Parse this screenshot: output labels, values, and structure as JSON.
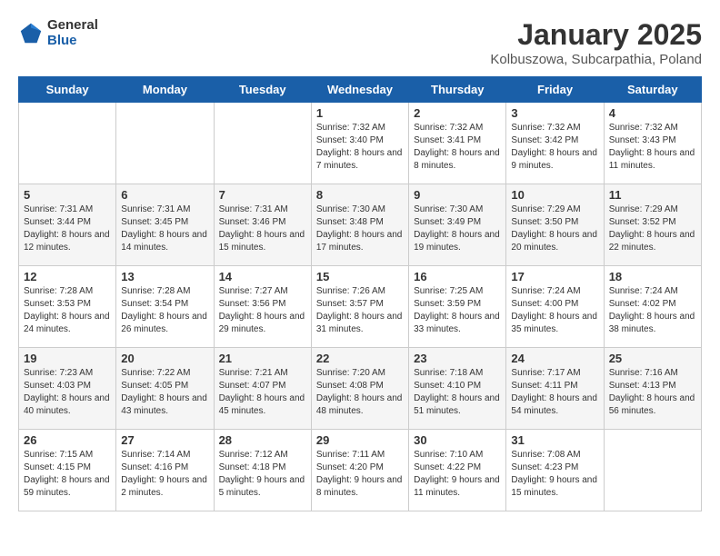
{
  "header": {
    "logo_general": "General",
    "logo_blue": "Blue",
    "title": "January 2025",
    "subtitle": "Kolbuszowa, Subcarpathia, Poland"
  },
  "days_of_week": [
    "Sunday",
    "Monday",
    "Tuesday",
    "Wednesday",
    "Thursday",
    "Friday",
    "Saturday"
  ],
  "weeks": [
    [
      {
        "num": "",
        "text": ""
      },
      {
        "num": "",
        "text": ""
      },
      {
        "num": "",
        "text": ""
      },
      {
        "num": "1",
        "text": "Sunrise: 7:32 AM\nSunset: 3:40 PM\nDaylight: 8 hours and 7 minutes."
      },
      {
        "num": "2",
        "text": "Sunrise: 7:32 AM\nSunset: 3:41 PM\nDaylight: 8 hours and 8 minutes."
      },
      {
        "num": "3",
        "text": "Sunrise: 7:32 AM\nSunset: 3:42 PM\nDaylight: 8 hours and 9 minutes."
      },
      {
        "num": "4",
        "text": "Sunrise: 7:32 AM\nSunset: 3:43 PM\nDaylight: 8 hours and 11 minutes."
      }
    ],
    [
      {
        "num": "5",
        "text": "Sunrise: 7:31 AM\nSunset: 3:44 PM\nDaylight: 8 hours and 12 minutes."
      },
      {
        "num": "6",
        "text": "Sunrise: 7:31 AM\nSunset: 3:45 PM\nDaylight: 8 hours and 14 minutes."
      },
      {
        "num": "7",
        "text": "Sunrise: 7:31 AM\nSunset: 3:46 PM\nDaylight: 8 hours and 15 minutes."
      },
      {
        "num": "8",
        "text": "Sunrise: 7:30 AM\nSunset: 3:48 PM\nDaylight: 8 hours and 17 minutes."
      },
      {
        "num": "9",
        "text": "Sunrise: 7:30 AM\nSunset: 3:49 PM\nDaylight: 8 hours and 19 minutes."
      },
      {
        "num": "10",
        "text": "Sunrise: 7:29 AM\nSunset: 3:50 PM\nDaylight: 8 hours and 20 minutes."
      },
      {
        "num": "11",
        "text": "Sunrise: 7:29 AM\nSunset: 3:52 PM\nDaylight: 8 hours and 22 minutes."
      }
    ],
    [
      {
        "num": "12",
        "text": "Sunrise: 7:28 AM\nSunset: 3:53 PM\nDaylight: 8 hours and 24 minutes."
      },
      {
        "num": "13",
        "text": "Sunrise: 7:28 AM\nSunset: 3:54 PM\nDaylight: 8 hours and 26 minutes."
      },
      {
        "num": "14",
        "text": "Sunrise: 7:27 AM\nSunset: 3:56 PM\nDaylight: 8 hours and 29 minutes."
      },
      {
        "num": "15",
        "text": "Sunrise: 7:26 AM\nSunset: 3:57 PM\nDaylight: 8 hours and 31 minutes."
      },
      {
        "num": "16",
        "text": "Sunrise: 7:25 AM\nSunset: 3:59 PM\nDaylight: 8 hours and 33 minutes."
      },
      {
        "num": "17",
        "text": "Sunrise: 7:24 AM\nSunset: 4:00 PM\nDaylight: 8 hours and 35 minutes."
      },
      {
        "num": "18",
        "text": "Sunrise: 7:24 AM\nSunset: 4:02 PM\nDaylight: 8 hours and 38 minutes."
      }
    ],
    [
      {
        "num": "19",
        "text": "Sunrise: 7:23 AM\nSunset: 4:03 PM\nDaylight: 8 hours and 40 minutes."
      },
      {
        "num": "20",
        "text": "Sunrise: 7:22 AM\nSunset: 4:05 PM\nDaylight: 8 hours and 43 minutes."
      },
      {
        "num": "21",
        "text": "Sunrise: 7:21 AM\nSunset: 4:07 PM\nDaylight: 8 hours and 45 minutes."
      },
      {
        "num": "22",
        "text": "Sunrise: 7:20 AM\nSunset: 4:08 PM\nDaylight: 8 hours and 48 minutes."
      },
      {
        "num": "23",
        "text": "Sunrise: 7:18 AM\nSunset: 4:10 PM\nDaylight: 8 hours and 51 minutes."
      },
      {
        "num": "24",
        "text": "Sunrise: 7:17 AM\nSunset: 4:11 PM\nDaylight: 8 hours and 54 minutes."
      },
      {
        "num": "25",
        "text": "Sunrise: 7:16 AM\nSunset: 4:13 PM\nDaylight: 8 hours and 56 minutes."
      }
    ],
    [
      {
        "num": "26",
        "text": "Sunrise: 7:15 AM\nSunset: 4:15 PM\nDaylight: 8 hours and 59 minutes."
      },
      {
        "num": "27",
        "text": "Sunrise: 7:14 AM\nSunset: 4:16 PM\nDaylight: 9 hours and 2 minutes."
      },
      {
        "num": "28",
        "text": "Sunrise: 7:12 AM\nSunset: 4:18 PM\nDaylight: 9 hours and 5 minutes."
      },
      {
        "num": "29",
        "text": "Sunrise: 7:11 AM\nSunset: 4:20 PM\nDaylight: 9 hours and 8 minutes."
      },
      {
        "num": "30",
        "text": "Sunrise: 7:10 AM\nSunset: 4:22 PM\nDaylight: 9 hours and 11 minutes."
      },
      {
        "num": "31",
        "text": "Sunrise: 7:08 AM\nSunset: 4:23 PM\nDaylight: 9 hours and 15 minutes."
      },
      {
        "num": "",
        "text": ""
      }
    ]
  ]
}
